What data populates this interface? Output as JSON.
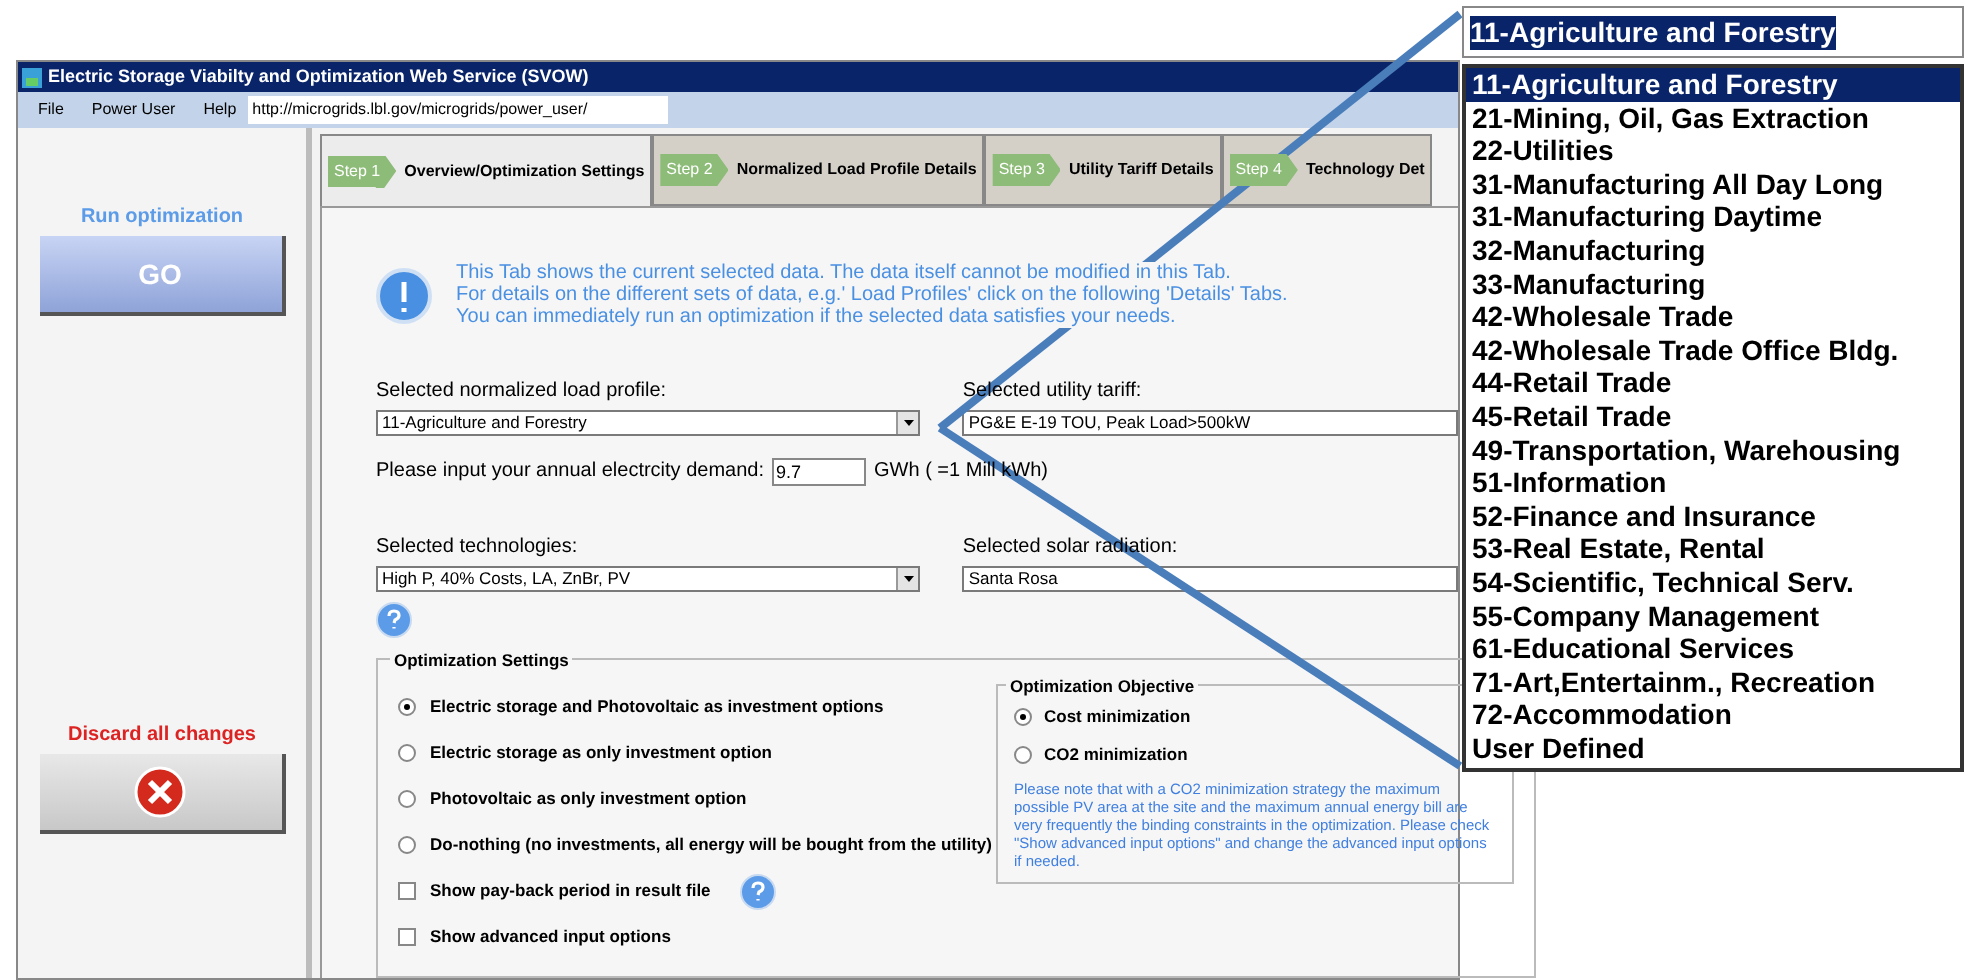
{
  "window": {
    "title": "Electric Storage Viabilty and Optimization Web Service (SVOW)"
  },
  "menu": [
    "File",
    "Power User",
    "Help"
  ],
  "address": "http://microgrids.lbl.gov/microgrids/power_user/",
  "sidebar": {
    "run_label": "Run optimization",
    "go_button": "GO",
    "discard_label": "Discard all changes"
  },
  "tabs": [
    {
      "step": "Step 1",
      "label": "Overview/Optimization Settings",
      "selected": true
    },
    {
      "step": "Step 2",
      "label": "Normalized Load Profile Details",
      "selected": false
    },
    {
      "step": "Step 3",
      "label": "Utility Tariff Details",
      "selected": false
    },
    {
      "step": "Step 4",
      "label": "Technology Det",
      "selected": false
    }
  ],
  "info_lines": [
    "This Tab shows the current selected data. The data itself cannot be modified in this Tab.",
    "For details on the different sets of data, e.g.' Load Profiles' click on the following 'Details' Tabs.",
    "You can immediately run an optimization if the selected data satisfies your needs."
  ],
  "load_profile": {
    "label": "Selected normalized load profile:",
    "value": "11-Agriculture and Forestry"
  },
  "tariff": {
    "label": "Selected utility tariff:",
    "value": "PG&E E-19 TOU, Peak Load>500kW"
  },
  "demand": {
    "label": "Please input your annual electrcity demand:",
    "value": "9.7",
    "unit": "GWh ( =1 Mill kWh)"
  },
  "technologies": {
    "label": "Selected technologies:",
    "value": "High P, 40% Costs, LA, ZnBr, PV"
  },
  "solar": {
    "label": "Selected solar radiation:",
    "value": "Santa Rosa"
  },
  "optimization_settings": {
    "title": "Optimization Settings",
    "options": [
      {
        "kind": "radio",
        "label": "Electric storage and Photovoltaic as investment options",
        "selected": true,
        "help": false
      },
      {
        "kind": "radio",
        "label": "Electric storage as only investment option",
        "selected": false,
        "help": false
      },
      {
        "kind": "radio",
        "label": "Photovoltaic as only investment option",
        "selected": false,
        "help": false
      },
      {
        "kind": "radio",
        "label": "Do-nothing (no investments, all energy will be bought from the utility)",
        "selected": false,
        "help": false
      },
      {
        "kind": "checkbox",
        "label": "Show pay-back period in result file",
        "checked": false,
        "help": true
      },
      {
        "kind": "checkbox",
        "label": "Show advanced input options",
        "checked": false,
        "help": false
      }
    ]
  },
  "objective": {
    "title": "Optimization Objective",
    "options": [
      {
        "label": "Cost minimization",
        "selected": true
      },
      {
        "label": "CO2 minimization",
        "selected": false
      }
    ],
    "note": "Please note that with a CO2 minimization strategy the maximum possible PV area at the site and the maximum annual energy bill are very frequently the binding constraints in the optimization. Please check \"Show advanced input options\" and change the advanced input options if needed."
  },
  "zoom_callout": {
    "value": "11-Agriculture and Forestry",
    "items": [
      {
        "label": "11-Agriculture and Forestry",
        "selected": true
      },
      {
        "label": "21-Mining, Oil, Gas Extraction",
        "selected": false
      },
      {
        "label": "22-Utilities",
        "selected": false
      },
      {
        "label": "31-Manufacturing All Day Long",
        "selected": false
      },
      {
        "label": "31-Manufacturing Daytime",
        "selected": false
      },
      {
        "label": "32-Manufacturing",
        "selected": false
      },
      {
        "label": "33-Manufacturing",
        "selected": false
      },
      {
        "label": "42-Wholesale Trade",
        "selected": false
      },
      {
        "label": "42-Wholesale Trade Office Bldg.",
        "selected": false
      },
      {
        "label": "44-Retail Trade",
        "selected": false
      },
      {
        "label": "45-Retail Trade",
        "selected": false
      },
      {
        "label": "49-Transportation, Warehousing",
        "selected": false
      },
      {
        "label": "51-Information",
        "selected": false
      },
      {
        "label": "52-Finance and Insurance",
        "selected": false
      },
      {
        "label": "53-Real Estate, Rental",
        "selected": false
      },
      {
        "label": "54-Scientific, Technical Serv.",
        "selected": false
      },
      {
        "label": "55-Company Management",
        "selected": false
      },
      {
        "label": "61-Educational Services",
        "selected": false
      },
      {
        "label": "71-Art,Entertainm., Recreation",
        "selected": false
      },
      {
        "label": "72-Accommodation",
        "selected": false
      },
      {
        "label": "User Defined",
        "selected": false
      }
    ]
  }
}
